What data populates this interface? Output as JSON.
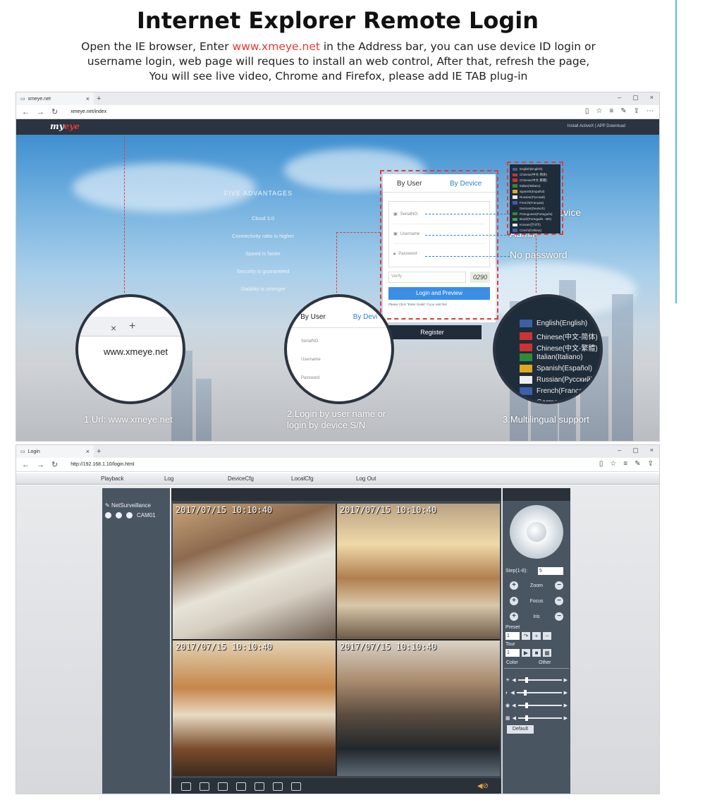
{
  "header": {
    "title": "Internet Explorer Remote Login",
    "desc_before": "Open the IE browser, Enter ",
    "desc_link": "www.xmeye.net",
    "desc_after": " in the Address bar, you can use device ID login or username login, web page will reques to install an web control, After that, refresh the page, You will see live video, Chrome and Firefox, please add IE TAB plug-in"
  },
  "browser1": {
    "tab_title": "xmeye.net",
    "url": "xmeye.net/index",
    "site_logo_a": "my",
    "site_logo_b": "eye",
    "site_links": "Install ActiveX  |  APP Download",
    "advantages_title": "FIVE ADVANTAGES",
    "advantages": [
      "Cloud 3.0",
      "Connectivity ratio is higher",
      "Speed is faster",
      "Security is guaranteed",
      "Stability is stronger"
    ],
    "login": {
      "tab_user": "By User",
      "tab_device": "By Device",
      "serial_placeholder": "SerialNO.",
      "username_placeholder": "Username",
      "password_placeholder": "Password",
      "verify_placeholder": "Verify",
      "captcha": "0290",
      "button": "Login and Preview",
      "hint": "Please Click \"Enter Guide\" if you visit first",
      "register": "Register"
    },
    "annotations": {
      "device": "Enter the device",
      "admin": "Admin",
      "password": "No password"
    },
    "languages": [
      "English(English)",
      "Chinese(中文-简体)",
      "Chinese(中文-繁體)",
      "Italian(Italiano)",
      "Spanish(Español)",
      "Russian(Русский)",
      "French(Français)",
      "German(Deutsch)",
      "Portuguese(Português)",
      "Brazil(Português - BR)",
      "Korean(한국어)",
      "Czech(Čeština)"
    ],
    "circle1": {
      "url": "www.xmeye.net",
      "caption": "1.Url: www.xmeye.net"
    },
    "circle2": {
      "tab_user": "By User",
      "tab_device": "By Devi",
      "f1": "SerialNO.",
      "f2": "Username",
      "f3": "Password",
      "caption_line1": "2.Login by user name or",
      "caption_line2": "login by device S/N"
    },
    "circle3": {
      "items": [
        "English(English)",
        "Chinese(中文-简体)",
        "Chinese(中文-繁體)",
        "Italian(Italiano)",
        "Spanish(Español)",
        "Russian(Русский)",
        "French(Françai",
        "German(D"
      ],
      "caption": "3.Multilingual support"
    }
  },
  "browser2": {
    "tab_title": "Login",
    "url": "http://192.168.1.10/login.html",
    "menu": [
      "Playback",
      "Log",
      "DeviceCfg",
      "LocalCfg",
      "Log Out"
    ],
    "tree_root": "NetSurveillance",
    "camera": "CAM01",
    "timestamps": [
      "2017/07/15  10:10:40",
      "2017/07/15  10:10:40",
      "2017/07/15  10:10:40",
      "2017/07/15  10:10:40"
    ],
    "ptz": {
      "step_label": "Step(1-8):",
      "step_value": "5",
      "zoom": "Zoom",
      "focus": "Focus",
      "iris": "Iris",
      "preset": "Preset",
      "preset_value": "1",
      "tour": "Tour",
      "tour_value": "1",
      "color_tab": "Color",
      "other_tab": "Other",
      "default": "Default"
    }
  }
}
